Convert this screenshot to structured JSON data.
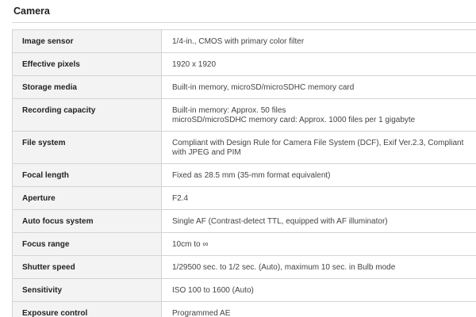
{
  "section": {
    "title": "Camera"
  },
  "specs": [
    {
      "label": "Image sensor",
      "value": [
        "1/4-in., CMOS with primary color filter"
      ]
    },
    {
      "label": "Effective pixels",
      "value": [
        "1920 x 1920"
      ]
    },
    {
      "label": "Storage media",
      "value": [
        "Built-in memory, microSD/microSDHC memory card"
      ]
    },
    {
      "label": "Recording capacity",
      "value": [
        "Built-in memory: Approx. 50 files",
        "microSD/microSDHC memory card: Approx. 1000 files per 1 gigabyte"
      ]
    },
    {
      "label": "File system",
      "value": [
        "Compliant with Design Rule for Camera File System (DCF), Exif Ver.2.3, Compliant with JPEG and PIM"
      ]
    },
    {
      "label": "Focal length",
      "value": [
        "Fixed as 28.5 mm (35-mm format equivalent)"
      ]
    },
    {
      "label": "Aperture",
      "value": [
        "F2.4"
      ]
    },
    {
      "label": "Auto focus system",
      "value": [
        "Single AF (Contrast-detect TTL, equipped with AF illuminator)"
      ]
    },
    {
      "label": "Focus range",
      "value": [
        "10cm to ∞"
      ]
    },
    {
      "label": "Shutter speed",
      "value": [
        "1/29500 sec. to 1/2 sec. (Auto), maximum 10 sec. in Bulb mode"
      ]
    },
    {
      "label": "Sensitivity",
      "value": [
        "ISO 100 to 1600 (Auto)"
      ]
    },
    {
      "label": "Exposure control",
      "value": [
        "Programmed AE"
      ]
    }
  ]
}
